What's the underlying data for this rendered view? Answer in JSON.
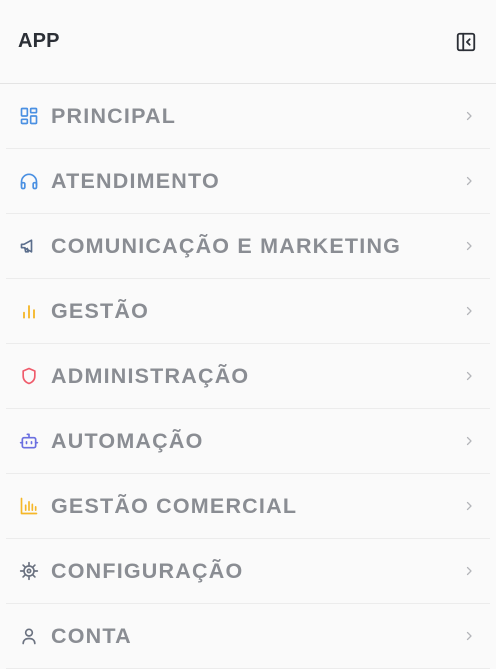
{
  "app": {
    "title": "APP"
  },
  "header": {
    "collapse_icon": "sidebar-collapse-icon"
  },
  "menu": {
    "items": [
      {
        "label": "PRINCIPAL",
        "icon": "dashboard-grid-icon",
        "color": "#4a90e2"
      },
      {
        "label": "ATENDIMENTO",
        "icon": "headphones-icon",
        "color": "#4a90e2"
      },
      {
        "label": "COMUNICAÇÃO E MARKETING",
        "icon": "megaphone-icon",
        "color": "#5b6e8c"
      },
      {
        "label": "GESTÃO",
        "icon": "bar-chart-icon",
        "color": "#f5b728"
      },
      {
        "label": "ADMINISTRAÇÃO",
        "icon": "shield-icon",
        "color": "#ef5b6b"
      },
      {
        "label": "AUTOMAÇÃO",
        "icon": "bot-icon",
        "color": "#6a6fe0"
      },
      {
        "label": "GESTÃO COMERCIAL",
        "icon": "bar-chart-axis-icon",
        "color": "#f5b728"
      },
      {
        "label": "CONFIGURAÇÃO",
        "icon": "settings-cog-icon",
        "color": "#6b7280"
      },
      {
        "label": "CONTA",
        "icon": "user-icon",
        "color": "#6b7280"
      }
    ]
  },
  "colors": {
    "text_muted": "#8a8d93",
    "chevron": "#b4b6ba",
    "divider": "#ececec"
  }
}
